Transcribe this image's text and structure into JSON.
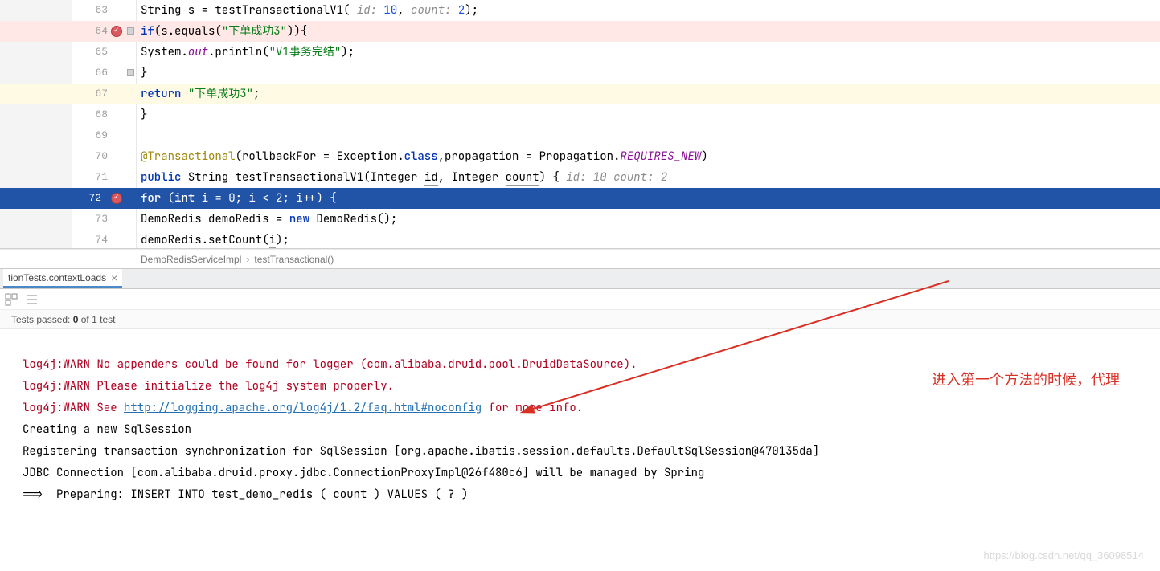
{
  "editor": {
    "lines": [
      {
        "n": 63
      },
      {
        "n": 64,
        "bp": true
      },
      {
        "n": 65
      },
      {
        "n": 66
      },
      {
        "n": 67
      },
      {
        "n": 68
      },
      {
        "n": 69
      },
      {
        "n": 70
      },
      {
        "n": 71
      },
      {
        "n": 72,
        "bp": true,
        "exec": true
      },
      {
        "n": 73
      },
      {
        "n": 74
      }
    ],
    "code": {
      "l63_pre": "        String s = testTransactionalV1( ",
      "l63_hint1": "id: ",
      "l63_v1": "10",
      "l63_mid": ",  ",
      "l63_hint2": "count: ",
      "l63_v2": "2",
      "l63_post": ");",
      "l64_kw": "if",
      "l64_body": "(s.equals(",
      "l64_str": "\"下单成功3\"",
      "l64_end": ")){",
      "l65_a": "            System.",
      "l65_out": "out",
      "l65_b": ".println(",
      "l65_str": "\"V1事务完结\"",
      "l65_c": ");",
      "l66": "        }",
      "l67_ret": "return",
      "l67_sp": " ",
      "l67_str": "\"下单成功3\"",
      "l67_end": ";",
      "l68": "    }",
      "l69": "",
      "l70_ann": "@Transactional",
      "l70_a": "(rollbackFor = Exception.",
      "l70_cls": "class",
      "l70_b": ",propagation = Propagation.",
      "l70_const": "REQUIRES_NEW",
      "l70_c": ")",
      "l71_pub": "public",
      "l71_sp1": "  ",
      "l71_str": "String ",
      "l71_m": "testTransactionalV1",
      "l71_a": "(Integer ",
      "l71_p1": "id",
      "l71_b": ", Integer ",
      "l71_p2": "count",
      "l71_c": ") {  ",
      "l71_h1": "id: 10  count: 2",
      "l72_for": "for",
      "l72_a": " (",
      "l72_int": "int",
      "l72_b": " i = ",
      "l72_z": "0",
      "l72_c": "; i < ",
      "l72_two": "2",
      "l72_d": "; i++) {",
      "l73_a": "            DemoRedis demoRedis = ",
      "l73_new": "new",
      "l73_b": " DemoRedis();",
      "l74_a": "            demoRedis.setCount(",
      "l74_i": "i",
      "l74_b": ");"
    }
  },
  "breadcrumb": {
    "item1": "DemoRedisServiceImpl",
    "item2": "testTransactional()"
  },
  "tab": {
    "label": "tionTests.contextLoads"
  },
  "tests": {
    "label_a": "Tests passed:",
    "passed": "0",
    "label_b": "of",
    "total": "1",
    "label_c": "test"
  },
  "console": {
    "l1": "log4j:WARN No appenders could be found for logger (com.alibaba.druid.pool.DruidDataSource).",
    "l2": "log4j:WARN Please initialize the log4j system properly.",
    "l3a": "log4j:WARN See ",
    "l3link": "http://logging.apache.org/log4j/1.2/faq.html#noconfig",
    "l3b": " for more info.",
    "l4": "Creating a new SqlSession",
    "l5": "Registering transaction synchronization for SqlSession [org.apache.ibatis.session.defaults.DefaultSqlSession@470135da]",
    "l6": "JDBC Connection [com.alibaba.druid.proxy.jdbc.ConnectionProxyImpl@26f480c6] will be managed by Spring",
    "l7": "==>  Preparing: INSERT INTO test_demo_redis ( count ) VALUES ( ? ) "
  },
  "annotation": "进入第一个方法的时候，代理",
  "watermark": "https://blog.csdn.net/qq_36098514"
}
